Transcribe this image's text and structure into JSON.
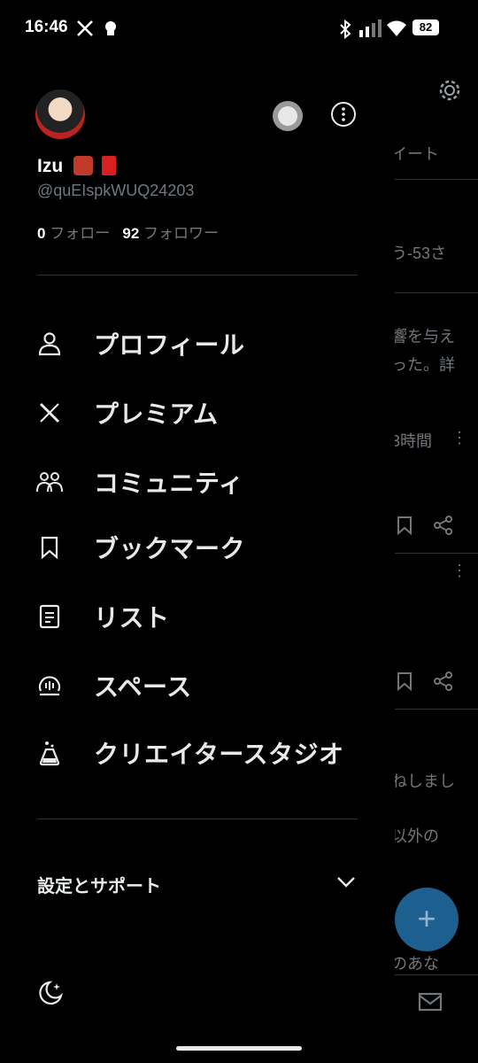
{
  "status_bar": {
    "time": "16:46",
    "battery": "82"
  },
  "profile": {
    "name": "Izu",
    "handle": "@quEIspkWUQ24203",
    "following_count": "0",
    "following_label": "フォロー",
    "followers_count": "92",
    "followers_label": "フォロワー"
  },
  "menu": {
    "items": [
      {
        "label": "プロフィール",
        "icon": "person-icon"
      },
      {
        "label": "プレミアム",
        "icon": "x-logo-icon"
      },
      {
        "label": "コミュニティ",
        "icon": "communities-icon"
      },
      {
        "label": "ブックマーク",
        "icon": "bookmark-icon"
      },
      {
        "label": "リスト",
        "icon": "list-icon"
      },
      {
        "label": "スペース",
        "icon": "spaces-icon"
      },
      {
        "label": "クリエイタースタジオ",
        "icon": "flask-icon"
      }
    ],
    "settings_label": "設定とサポート"
  },
  "background": {
    "snippets": [
      "イート",
      "う-53さ",
      "響を与え",
      "った。詳",
      "3時間",
      "ねしまし",
      "以外の",
      "のあな"
    ]
  }
}
